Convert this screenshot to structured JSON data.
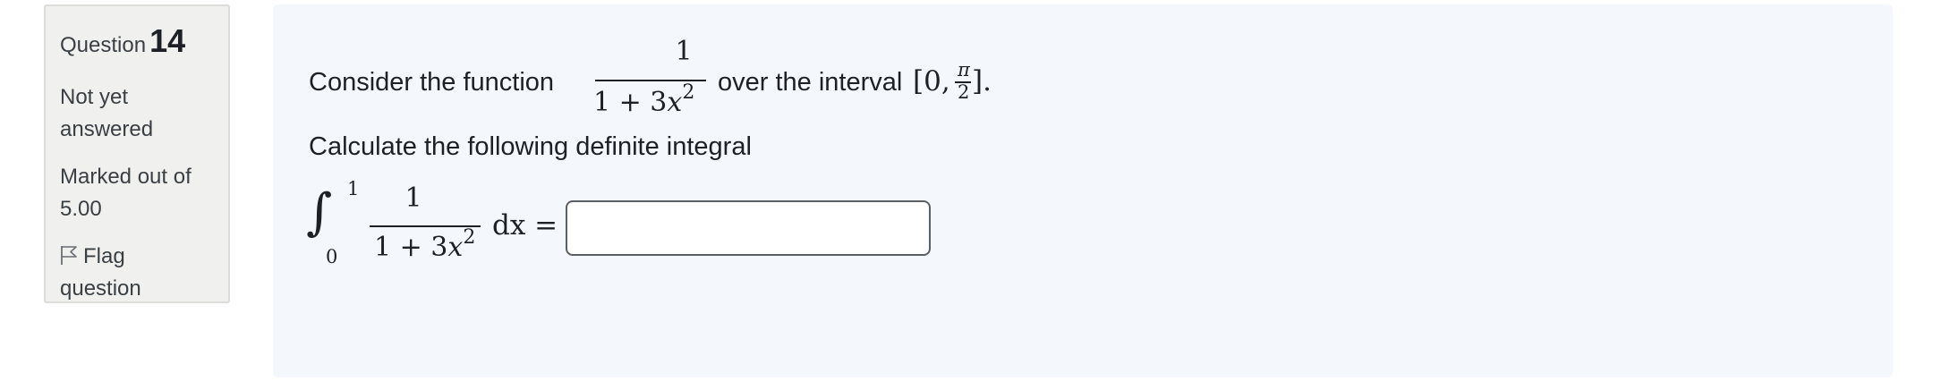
{
  "question_info": {
    "label": "Question",
    "number": "14",
    "state": "Not yet answered",
    "grade": "Marked out of 5.00",
    "flag_label": "Flag question",
    "flag_icon": "flag-outline-icon"
  },
  "question": {
    "intro_text": "Consider the function",
    "function_numerator": "1",
    "function_denominator_base": "1 + 3",
    "function_denominator_var": "x",
    "function_denominator_exp": "2",
    "interval_text": "over the interval",
    "interval_open": "[0,",
    "interval_pi": "π",
    "interval_two": "2",
    "interval_close": "].",
    "prompt": "Calculate the following definite integral",
    "integral_sign": "∫",
    "integral_upper": "1",
    "integral_lower": "0",
    "integrand_numerator": "1",
    "integrand_denominator_base": "1 + 3",
    "integrand_denominator_var": "x",
    "integrand_denominator_exp": "2",
    "differential": "dx =",
    "answer_value": ""
  },
  "colors": {
    "info_background": "#f0f0ee",
    "content_background": "#f4f7fc",
    "text": "#1d2125",
    "input_border": "#5a5f64"
  }
}
